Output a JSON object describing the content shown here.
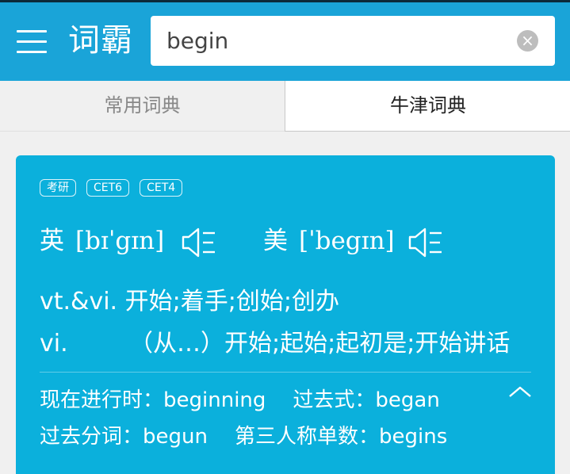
{
  "header": {
    "app_name": "词霸",
    "search": {
      "value": "begin",
      "clear_glyph": "×"
    }
  },
  "tabs": [
    {
      "label": "常用词典",
      "active": false
    },
    {
      "label": "牛津词典",
      "active": true
    }
  ],
  "word_card": {
    "tags": [
      "考研",
      "CET6",
      "CET4"
    ],
    "pronunciations": {
      "uk": {
        "lang": "英",
        "ipa": "[bɪˈgɪn]"
      },
      "us": {
        "lang": "美",
        "ipa": "[ˈbegɪn]"
      }
    },
    "definitions": [
      {
        "pos": "vt.&vi.",
        "meaning": "开始;着手;创始;创办"
      },
      {
        "pos": "vi.",
        "meaning": "（从…）开始;起始;起初是;开始讲话"
      }
    ],
    "forms": {
      "present_participle": {
        "label": "现在进行时：",
        "value": "beginning"
      },
      "past_tense": {
        "label": "过去式：",
        "value": "began"
      },
      "past_participle": {
        "label": "过去分词：",
        "value": "begun"
      },
      "third_person": {
        "label": "第三人称单数：",
        "value": "begins"
      }
    }
  },
  "icons": [
    "menu-icon",
    "clear-search-icon",
    "speaker-icon",
    "chevron-up-icon"
  ],
  "colors": {
    "primary": "#1aa4d8",
    "card": "#0bb0dc"
  }
}
